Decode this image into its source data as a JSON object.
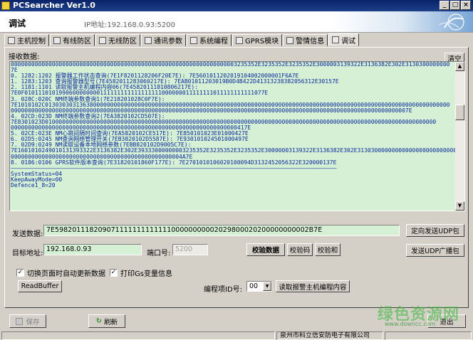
{
  "window": {
    "title": "PCSearcher Ver1.0"
  },
  "header": {
    "page_title": "调试",
    "ip_label": "IP地址:192.168.0.93:5200"
  },
  "tabs": [
    {
      "label": "主机控制",
      "icon": "host-icon"
    },
    {
      "label": "有线防区",
      "icon": "wired-zone-icon"
    },
    {
      "label": "无线防区",
      "icon": "wireless-zone-icon"
    },
    {
      "label": "通讯参数",
      "icon": "comm-param-icon"
    },
    {
      "label": "系统编程",
      "icon": "system-program-icon"
    },
    {
      "label": "GPRS模块",
      "icon": "gprs-icon"
    },
    {
      "label": "警情信息",
      "icon": "alarm-info-icon"
    },
    {
      "label": "调试",
      "icon": "gear-icon",
      "active": true
    }
  ],
  "receive": {
    "label": "接收数据:",
    "clear_label": "清空",
    "lines": [
      "000000000000000000000000000000000000000000000000000000000000000003235352E3235352E3235352E3000003139322E3136382E302E3130300000000",
      "7E",
      "0. 1282:1202 报警器工作状态查询(7E1F8201128206F20E7E): 7E5601011202019104002000001F6A7E",
      "1. 1283:1203 查询报警器型号(7E4582011283060217E): 7EAB01011203019B0D4B422D41313238382056312E30157E",
      "2. 1181:1101 读取报警主机编程内容06(7E45820111810806217E):",
      "7E0F0101110101990600000000111111111111111111000000011111111011111111111077E",
      "3. 028C:020C NM终端参数查询1(7E218201028C0F7E):",
      "7E1010102C0130303031363800000000000000000000000000000000000000000000000000000000000000000000000000000000000000000000000000000000",
      "00000000000000000000000000000000000000000000000000000000000000000000000000000000000000000000000000000000000000000007E",
      "4. 02CD:023D NM终端参数查询2(7EA3820102CD507E):",
      "7E8301023D010000000000000000000000000000000000000000000000000000000000000000000000000000000000000000000000000000000000000000",
      "000000000000000000000000000000000000000000000000000000000000000000417E",
      "5. 02CE:023E NM心跳间隔时间查询(7EA5820102CE517E): 7E850101023E01000427E",
      "6. 02D5:0245 NM查询网络管理开关(7EB3820102D5587E): 7E930101024501000497E",
      "7. 02D9:0249 NM读取设备本地网络参数(7EBB820102D9005C7E):",
      "7E1601010249010131393322E3136382E302E39333000000003235352E3235352E3235352E30000003139322E3136382E302E313030000000000000000000000000",
      "00000000000000000000000000000000000000000000000004A7E",
      "8. 0186:0106 GPRS软件版本查询(7E31820101860F177E): 7E2701010106020100094D3132452056322E320000137E",
      "———————————————————————————————————————————————————————————————————————————————————————————————",
      "SystemStatus=04",
      "KeepAwayMode=00",
      "Defence1_8=20"
    ]
  },
  "send": {
    "label": "发送数据:",
    "value": "7E59820111820907111111111111100000000002029800020200000000002B7E",
    "button_label": "定向发送UDP包"
  },
  "target": {
    "label": "目标地址:",
    "value": "192.168.0.93",
    "port_label": "端口号:",
    "port_value": "5200",
    "check_data_label": "校验数据",
    "checksum_code_label": "校验码",
    "checksum_sum_label": "校验和",
    "broadcast_label": "发送UDP广播包"
  },
  "options": {
    "auto_update_label": "切换页面时自动更新数据",
    "auto_update_checked": "✓",
    "print_gs_label": "打印Gs变量信息",
    "print_gs_checked": "✓"
  },
  "actions": {
    "read_buffer_label": "ReadBuffer",
    "program_id_label": "编程项ID号:",
    "program_id_value": "00",
    "read_program_label": "读取报警主机编程内容"
  },
  "bottom": {
    "save_label": "保存",
    "refresh_label": "刷新",
    "exit_label": "退出"
  },
  "status": {
    "company": "泉州市科立信安防电子有限公司"
  },
  "watermark": {
    "main": "绿色资源网",
    "sub": "www.downcc.com"
  }
}
